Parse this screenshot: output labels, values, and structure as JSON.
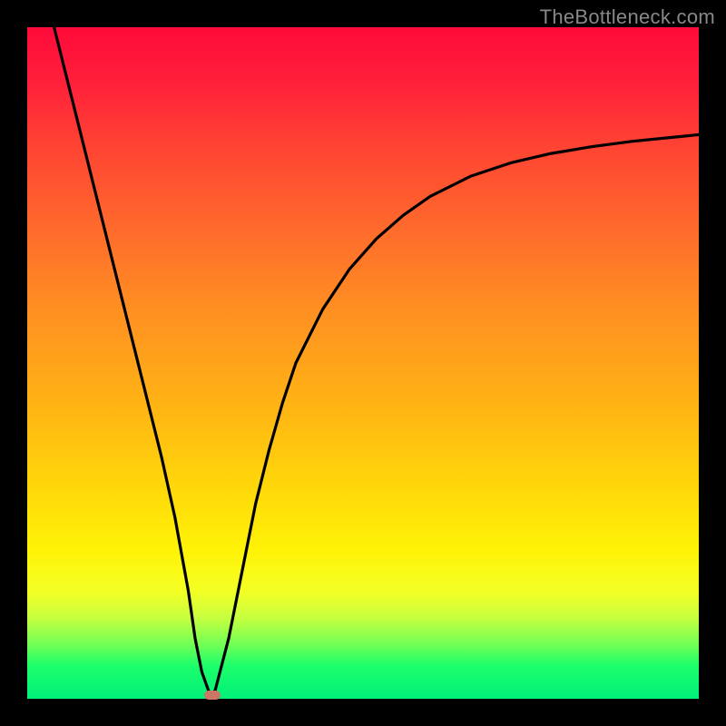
{
  "attribution": "TheBottleneck.com",
  "colors": {
    "page_bg": "#000000",
    "gradient_top": "#ff0a3a",
    "gradient_bottom": "#00f07a",
    "curve": "#000000",
    "marker": "#cc7766",
    "attribution_text": "#888888"
  },
  "chart_data": {
    "type": "line",
    "title": "",
    "xlabel": "",
    "ylabel": "",
    "xlim": [
      0,
      100
    ],
    "ylim": [
      0,
      100
    ],
    "series": [
      {
        "name": "bottleneck-curve",
        "x": [
          4,
          6,
          8,
          10,
          12,
          14,
          16,
          18,
          20,
          22,
          24,
          25,
          26,
          27,
          27.5,
          28,
          30,
          32,
          34,
          36,
          38,
          40,
          44,
          48,
          52,
          56,
          60,
          66,
          72,
          78,
          84,
          90,
          96,
          100
        ],
        "y": [
          100,
          92,
          84,
          76,
          68,
          60,
          52,
          44,
          36,
          27,
          16,
          9,
          4,
          1.2,
          0.6,
          1.3,
          9,
          19,
          29,
          37,
          44,
          50,
          58,
          64,
          68.5,
          72,
          74.8,
          77.8,
          79.8,
          81.2,
          82.2,
          83.0,
          83.6,
          84.0
        ]
      }
    ],
    "marker": {
      "x": 27.5,
      "y": 0.6,
      "label": ""
    },
    "grid": false,
    "legend": false
  }
}
